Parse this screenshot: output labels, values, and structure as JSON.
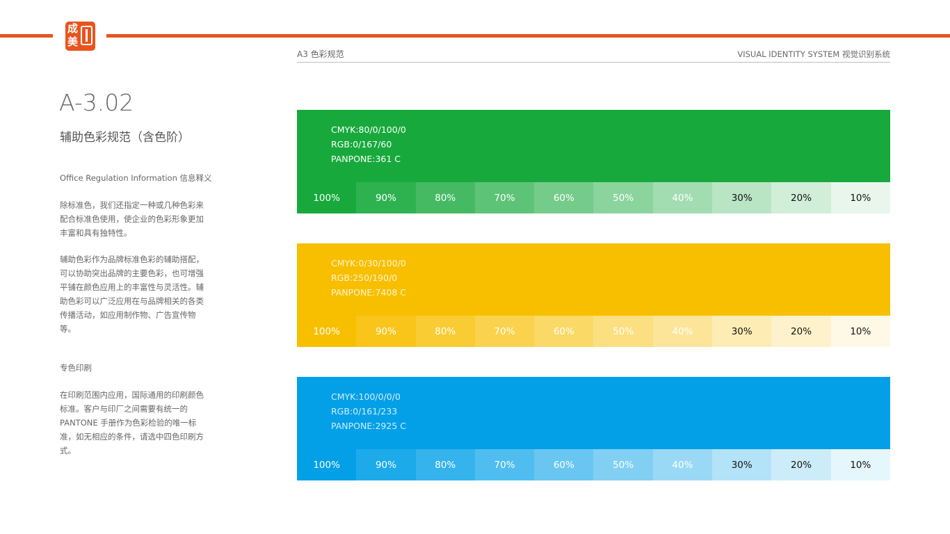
{
  "logo": {
    "char1": "成",
    "char2": "美"
  },
  "header": {
    "section": "A3 色彩规范",
    "system": "VISUAL IDENTITY SYSTEM 视觉识别系统"
  },
  "left": {
    "code": "A-3.02",
    "subtitle": "辅助色彩规范（含色阶）",
    "section_title": "Office Regulation Information 信息释义",
    "para1": "除标准色，我们还指定一种或几种色彩来配合标准色使用，使企业的色彩形象更加丰富和具有独特性。",
    "para2": "辅助色彩作为品牌标准色彩的辅助搭配，可以协助突出品牌的主要色彩，也可增强平铺在颜色应用上的丰富性与灵活性。辅助色彩可以广泛应用在与品牌相关的各类传播活动，如应用制作物、广告宣传物等。",
    "section2_title": "专色印刷",
    "para3": "在印刷范围内应用，国际通用的印刷颜色标准。客户与印厂之间需要有统一的PANTONE 手册作为色彩检验的唯一标准，如无相应的条件，请选中四色印刷方式。"
  },
  "colors": [
    {
      "name": "green",
      "hex": "#17a93c",
      "rgb": [
        23,
        169,
        60
      ],
      "cmyk": "CMYK:80/0/100/0",
      "rgb_label": "RGB:0/167/60",
      "pantone": "PANPONE:361 C",
      "tints": [
        "100%",
        "90%",
        "80%",
        "70%",
        "60%",
        "50%",
        "40%",
        "30%",
        "20%",
        "10%"
      ]
    },
    {
      "name": "yellow",
      "hex": "#f8bf00",
      "rgb": [
        248,
        191,
        0
      ],
      "cmyk": "CMYK:0/30/100/0",
      "rgb_label": "RGB:250/190/0",
      "pantone": "PANPONE:7408 C",
      "tints": [
        "100%",
        "90%",
        "80%",
        "70%",
        "60%",
        "50%",
        "40%",
        "30%",
        "20%",
        "10%"
      ]
    },
    {
      "name": "blue",
      "hex": "#03a0e8",
      "rgb": [
        3,
        160,
        232
      ],
      "cmyk": "CMYK:100/0/0/0",
      "rgb_label": "RGB:0/161/233",
      "pantone": "PANPONE:2925 C",
      "tints": [
        "100%",
        "90%",
        "80%",
        "70%",
        "60%",
        "50%",
        "40%",
        "30%",
        "20%",
        "10%"
      ]
    }
  ],
  "tint_levels": [
    1.0,
    0.9,
    0.8,
    0.7,
    0.6,
    0.5,
    0.4,
    0.3,
    0.2,
    0.1
  ],
  "accent_color": "#e8541e"
}
